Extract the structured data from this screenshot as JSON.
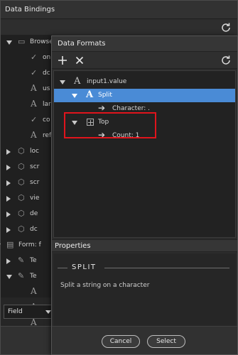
{
  "bindings": {
    "title": "Data Bindings",
    "tree": [
      {
        "label": "Browse",
        "icon": "window-icon",
        "twisty": "expanded"
      },
      {
        "label": "on",
        "icon": "check-icon",
        "twisty": ""
      },
      {
        "label": "dc",
        "icon": "check-icon",
        "twisty": ""
      },
      {
        "label": "us",
        "icon": "text-icon",
        "twisty": ""
      },
      {
        "label": "lar",
        "icon": "text-icon",
        "twisty": ""
      },
      {
        "label": "co",
        "icon": "check-icon",
        "twisty": ""
      },
      {
        "label": "ref",
        "icon": "text-icon",
        "twisty": ""
      },
      {
        "label": "loc",
        "icon": "cube-icon",
        "twisty": "collapsed"
      },
      {
        "label": "scr",
        "icon": "cube-icon",
        "twisty": "collapsed"
      },
      {
        "label": "scr",
        "icon": "cube-icon",
        "twisty": "collapsed"
      },
      {
        "label": "vie",
        "icon": "cube-icon",
        "twisty": "collapsed"
      },
      {
        "label": "de",
        "icon": "cube-icon",
        "twisty": "collapsed"
      },
      {
        "label": "dc",
        "icon": "cube-icon",
        "twisty": "collapsed"
      },
      {
        "label": "Form: f",
        "icon": "document-icon",
        "twisty": "expanded"
      },
      {
        "label": "Te",
        "icon": "pencil-icon",
        "twisty": "collapsed"
      },
      {
        "label": "Te",
        "icon": "pencil-icon",
        "twisty": "expanded"
      },
      {
        "label": "",
        "icon": "text-icon",
        "twisty": ""
      },
      {
        "label": "",
        "icon": "text-icon",
        "twisty": ""
      },
      {
        "label": "",
        "icon": "text-icon",
        "twisty": ""
      }
    ],
    "type_select_value": "Field"
  },
  "formats": {
    "title": "Data Formats",
    "tree": {
      "root": "input1.value",
      "split": "Split",
      "split_child": "Character: .",
      "top": "Top",
      "top_child": "Count: 1"
    },
    "properties_title": "Properties",
    "section_title": "SPLIT",
    "description": "Split a string on a character",
    "cancel_label": "Cancel",
    "select_label": "Select"
  },
  "colors": {
    "selection": "#4a8bd6",
    "highlight_box": "#e0141c"
  }
}
